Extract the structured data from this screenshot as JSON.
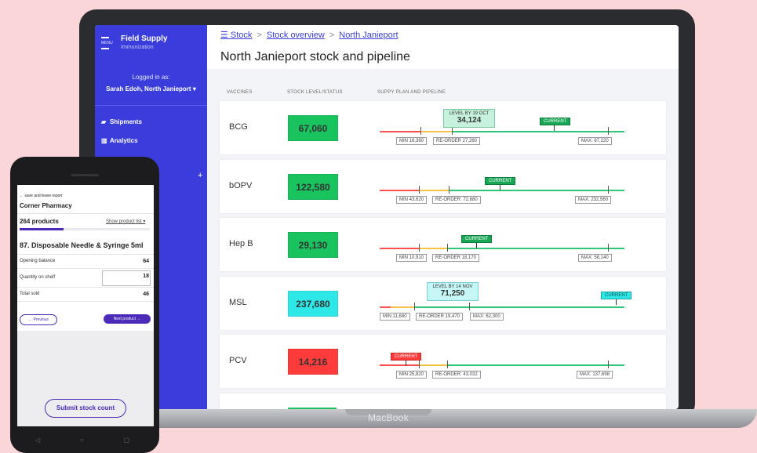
{
  "laptop_label": "MacBook",
  "sidebar": {
    "menu_label": "MENU",
    "app_title": "Field Supply",
    "app_subtitle": "Immunization",
    "logged_in_label": "Logged in as:",
    "user": "Sarah Edoh, North Janieport ▾",
    "nav": [
      {
        "label": "Shipments",
        "icon": "truck-icon"
      },
      {
        "label": "Analytics",
        "icon": "chart-icon"
      }
    ],
    "plus": "+"
  },
  "header": {
    "crumbs": [
      "☰ Stock",
      "Stock overview",
      "North Janieport"
    ],
    "crumb_sep": ">",
    "title": "North Janieport stock and pipeline"
  },
  "columns": [
    "VACCINES",
    "STOCK LEVEL/STATUS",
    "SUPPY PLAN AND PIPELINE"
  ],
  "rows": [
    {
      "name": "BCG",
      "level": "67,060",
      "color": "#19c45f",
      "min": "MIN 16,360",
      "reorder": "RE-ORDER 27,260",
      "max": "MAX: 87,220",
      "current": "CURRENT",
      "forecast_label": "LEVEL BY 19 OCT",
      "forecast_value": "34,124"
    },
    {
      "name": "bOPV",
      "level": "122,580",
      "color": "#19c45f",
      "min": "MIN 43,620",
      "reorder": "RE-ORDER: 72,680",
      "max": "MAX: 232,560",
      "current": "CURRENT"
    },
    {
      "name": "Hep B",
      "level": "29,130",
      "color": "#19c45f",
      "min": "MIN 10,910",
      "reorder": "RE-ORDER 18,170",
      "max": "MAX: 58,140",
      "current": "CURRENT"
    },
    {
      "name": "MSL",
      "level": "237,680",
      "color": "#2ee8e8",
      "min": "MIN 11,680",
      "reorder": "RE-ORDER 19,470",
      "max": "MAX: 62,300",
      "current": "CURRENT",
      "forecast_label": "LEVEL BY 14 NOV",
      "forecast_value": "71,250"
    },
    {
      "name": "PCV",
      "level": "14,216",
      "color": "#ff3b3b",
      "min": "MIN 25,820",
      "reorder": "RE-ORDER: 43,032",
      "max": "MAX: 137,698",
      "current": "CURRENT"
    }
  ],
  "phone": {
    "back": "← save and leave report",
    "store": "Corner Pharmacy",
    "products": "264 products",
    "show_list": "Show product list ▾",
    "progress": 0.34,
    "product": "87. Disposable Needle & Syringe 5ml",
    "opening_label": "Opening balance",
    "opening_value": "64",
    "shelf_label": "Quantity on shelf",
    "shelf_value": "18",
    "sold_label": "Total sold",
    "sold_value": "46",
    "prev": "← Previous",
    "next": "Next product →",
    "submit": "Submit stock count"
  }
}
